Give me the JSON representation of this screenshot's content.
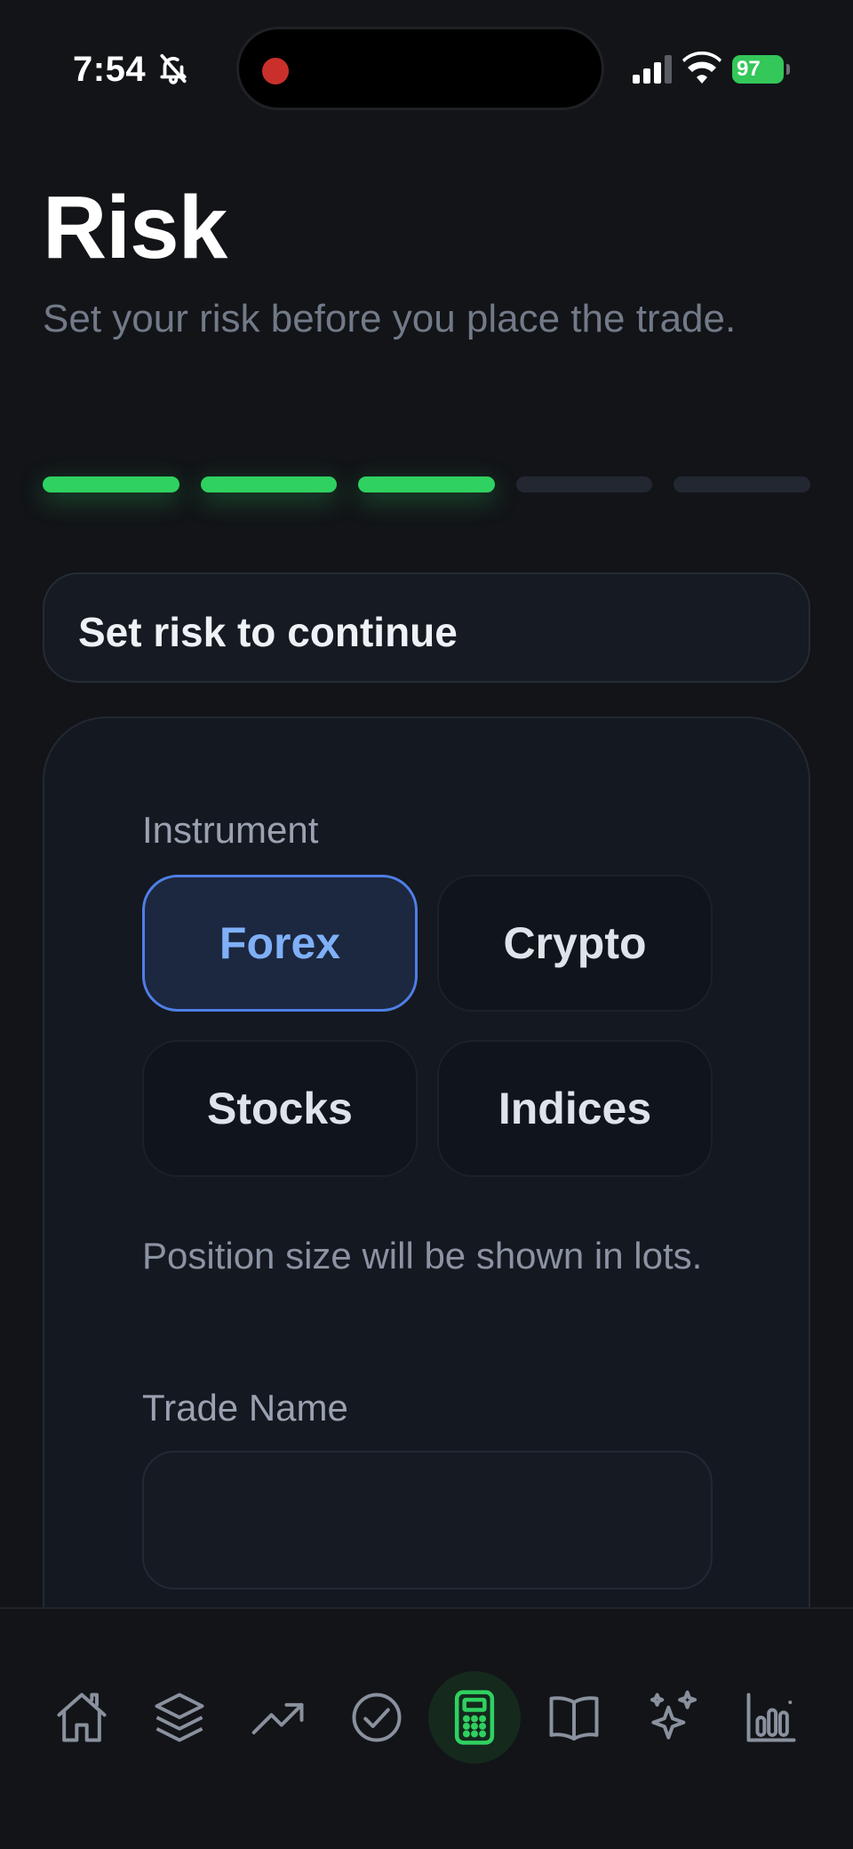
{
  "status_bar": {
    "time": "7:54",
    "battery": "97"
  },
  "header": {
    "title": "Risk",
    "subtitle": "Set your risk before you place the trade."
  },
  "progress": {
    "completed_steps": 3,
    "total_steps": 5
  },
  "banner": {
    "text": "Set risk to continue"
  },
  "form": {
    "instrument_label": "Instrument",
    "instruments": [
      "Forex",
      "Crypto",
      "Stocks",
      "Indices"
    ],
    "selected_instrument": "Forex",
    "hint": "Position size will be shown in lots.",
    "trade_name_label": "Trade Name",
    "trade_name_value": ""
  },
  "tabs": [
    {
      "icon": "home-icon"
    },
    {
      "icon": "layers-icon"
    },
    {
      "icon": "trending-up-icon"
    },
    {
      "icon": "check-circle-icon"
    },
    {
      "icon": "calculator-icon",
      "active": true
    },
    {
      "icon": "book-icon"
    },
    {
      "icon": "sparkles-icon"
    },
    {
      "icon": "bar-chart-icon"
    }
  ],
  "colors": {
    "background": "#121418",
    "accent_green": "#2fd160",
    "accent_blue": "#4f7fe6",
    "selected_text": "#7fb0f7"
  }
}
